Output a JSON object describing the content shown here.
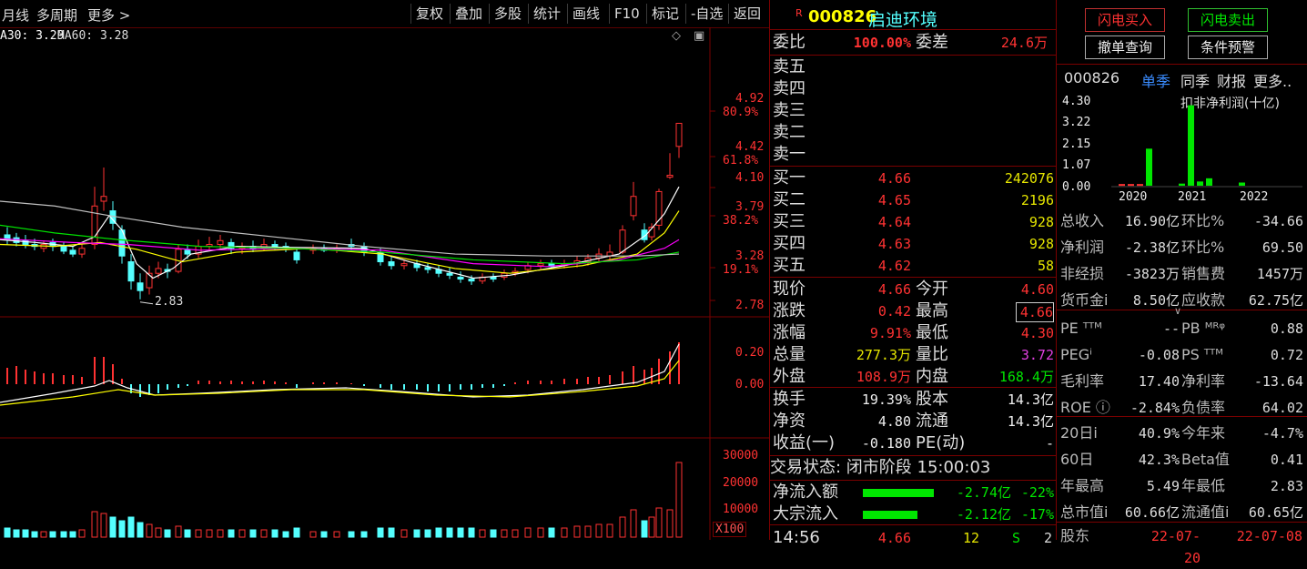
{
  "toolbar": {
    "left": [
      "月线",
      "多周期",
      "更多 >"
    ],
    "buttons": [
      "复权",
      "叠加",
      "多股",
      "统计",
      "画线",
      "F10",
      "标记",
      "-自选",
      "返回"
    ]
  },
  "chart": {
    "ma_label_1": "A30: 3.29",
    "ma_label_2": "MA60: 3.28",
    "price_axis": [
      "4.92",
      "80.9%",
      "4.42",
      "61.8%",
      "4.10",
      "3.79",
      "38.2%",
      "3.28",
      "19.1%",
      "2.78"
    ],
    "low_label": "2.83",
    "macd_axis": [
      "0.20",
      "0.00"
    ],
    "vol_axis": [
      "30000",
      "20000",
      "10000"
    ],
    "vol_unit": "X100",
    "colors": {
      "up": "#ff3232",
      "down": "#54ffff",
      "ma1": "#ffffff",
      "ma2": "#ffff00",
      "ma3": "#ff00ff",
      "ma4": "#00e000",
      "ma5": "#c0c0c0"
    }
  },
  "quote": {
    "badge": "R",
    "code": "000826",
    "name": "启迪环境",
    "weibi_label": "委比",
    "weibi": "100.00%",
    "weicha_label": "委差",
    "weicha": "24.6万",
    "sell": [
      "卖五",
      "卖四",
      "卖三",
      "卖二",
      "卖一"
    ],
    "buy": [
      {
        "label": "买一",
        "price": "4.66",
        "vol": "242076"
      },
      {
        "label": "买二",
        "price": "4.65",
        "vol": "2196"
      },
      {
        "label": "买三",
        "price": "4.64",
        "vol": "928"
      },
      {
        "label": "买四",
        "price": "4.63",
        "vol": "928"
      },
      {
        "label": "买五",
        "price": "4.62",
        "vol": "58"
      }
    ],
    "stats": [
      {
        "l1": "现价",
        "v1": "4.66",
        "l2": "今开",
        "v2": "4.60",
        "c1": "red",
        "c2": "red"
      },
      {
        "l1": "涨跌",
        "v1": "0.42",
        "l2": "最高",
        "v2": "4.66",
        "c1": "red",
        "c2": "red"
      },
      {
        "l1": "涨幅",
        "v1": "9.91%",
        "l2": "最低",
        "v2": "4.30",
        "c1": "red",
        "c2": "red"
      },
      {
        "l1": "总量",
        "v1": "277.3万",
        "l2": "量比",
        "v2": "3.72",
        "c1": "yel",
        "c2": "pur"
      },
      {
        "l1": "外盘",
        "v1": "108.9万",
        "l2": "内盘",
        "v2": "168.4万",
        "c1": "red",
        "c2": "green"
      }
    ],
    "stats2": [
      {
        "l1": "换手",
        "v1": "19.39%",
        "l2": "股本",
        "v2": "14.3亿"
      },
      {
        "l1": "净资",
        "v1": "4.80",
        "l2": "流通",
        "v2": "14.3亿"
      },
      {
        "l1": "收益(一)",
        "v1": "-0.180",
        "l2": "PE(动)",
        "v2": "-"
      }
    ],
    "status": "交易状态: 闭市阶段 15:00:03",
    "flow": [
      {
        "label": "净流入额",
        "value": "-2.74亿",
        "pct": "-22%",
        "bar": 0.78
      },
      {
        "label": "大宗流入",
        "value": "-2.12亿",
        "pct": "-17%",
        "bar": 0.6
      }
    ],
    "tick": {
      "time": "14:56",
      "price": "4.66",
      "vol": "12",
      "dir": "S",
      "num": "2"
    }
  },
  "right": {
    "btn_buy": "闪电买入",
    "btn_sell": "闪电卖出",
    "btn_cancel": "撤单查询",
    "btn_alert": "条件预警",
    "code": "000826",
    "tabs": [
      "单季",
      "同季",
      "财报",
      "更多.."
    ],
    "mini_title": "扣非净利润(十亿)",
    "mini_axis": [
      "4.30",
      "3.22",
      "2.15",
      "1.07",
      "0.00"
    ],
    "mini_years": [
      "2020",
      "2021",
      "2022"
    ],
    "mini_bars": [
      {
        "v": 0.08,
        "c": "red"
      },
      {
        "v": 0.08,
        "c": "red"
      },
      {
        "v": 0.08,
        "c": "red"
      },
      {
        "v": 1.75,
        "c": "green"
      },
      {
        "v": 0.1,
        "c": "green"
      },
      {
        "v": 3.8,
        "c": "green"
      },
      {
        "v": 0.2,
        "c": "green"
      },
      {
        "v": 0.35,
        "c": "green"
      },
      {
        "v": 0.15,
        "c": "green"
      }
    ],
    "rows": [
      {
        "l1": "总收入",
        "v1": "16.90亿",
        "l2": "环比%",
        "v2": "-34.66"
      },
      {
        "l1": "净利润",
        "v1": "-2.38亿",
        "l2": "环比%",
        "v2": "69.50"
      },
      {
        "l1": "非经损",
        "v1": "-3823万",
        "l2": "销售费",
        "v2": "1457万"
      },
      {
        "l1": "货币金i",
        "v1": "8.50亿",
        "l2": "应收款",
        "v2": "62.75亿"
      }
    ],
    "rows2": [
      {
        "l1": "PE ᵀᵀᴹ",
        "v1": "--",
        "l2": "PB ᴹᴿᵠ",
        "v2": "0.88"
      },
      {
        "l1": "PEGⁱ",
        "v1": "-0.08",
        "l2": "PS ᵀᵀᴹ",
        "v2": "0.72"
      },
      {
        "l1": "毛利率",
        "v1": "17.40",
        "l2": "净利率",
        "v2": "-13.64"
      },
      {
        "l1": "ROE ⓘ",
        "v1": "-2.84%",
        "l2": "负债率",
        "v2": "64.02"
      }
    ],
    "rows3": [
      {
        "l1": "20日i",
        "v1": "40.9%",
        "l2": "今年来",
        "v2": "-4.7%"
      },
      {
        "l1": "60日",
        "v1": "42.3%",
        "l2": "Beta值",
        "v2": "0.41"
      },
      {
        "l1": "年最高",
        "v1": "5.49",
        "l2": "年最低",
        "v2": "2.83"
      },
      {
        "l1": "总市值i",
        "v1": "60.66亿",
        "l2": "流通值i",
        "v2": "60.65亿"
      }
    ],
    "bottom": {
      "label": "股东",
      "d1": "22-07-20",
      "d2": "22-07-08"
    }
  }
}
